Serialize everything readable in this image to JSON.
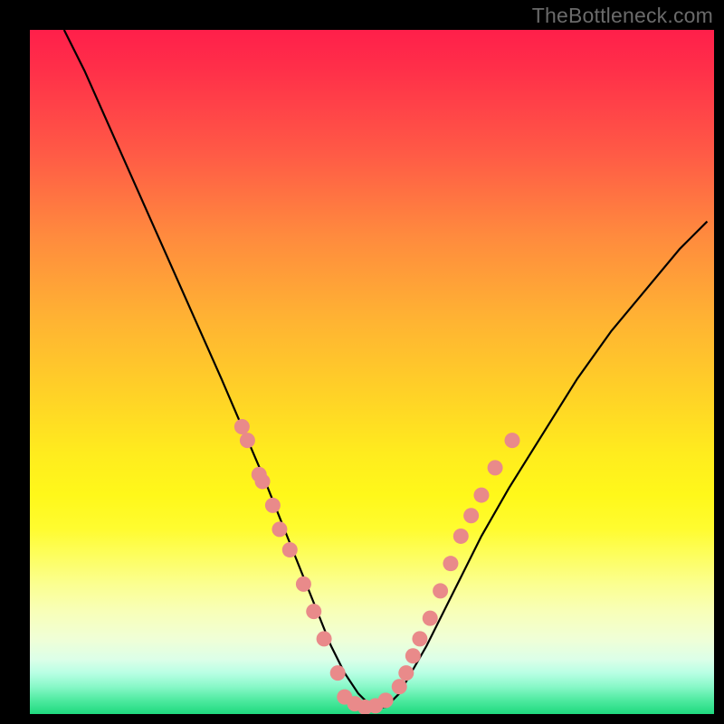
{
  "watermark": "TheBottleneck.com",
  "chart_data": {
    "type": "line",
    "title": "",
    "xlabel": "",
    "ylabel": "",
    "xlim": [
      0,
      100
    ],
    "ylim": [
      0,
      100
    ],
    "curve": {
      "name": "bottleneck-curve",
      "x": [
        5,
        8,
        12,
        16,
        20,
        24,
        28,
        31,
        34,
        36,
        38,
        40,
        42,
        44,
        46,
        48,
        50,
        52,
        54,
        58,
        62,
        66,
        70,
        75,
        80,
        85,
        90,
        95,
        99
      ],
      "y": [
        100,
        94,
        85,
        76,
        67,
        58,
        49,
        42,
        35,
        30,
        25,
        20,
        15,
        10,
        6,
        3,
        1,
        1,
        3,
        10,
        18,
        26,
        33,
        41,
        49,
        56,
        62,
        68,
        72
      ]
    },
    "scatter_left": {
      "name": "dots-left-branch",
      "color": "#e98a8a",
      "x": [
        31.0,
        31.8,
        33.5,
        34.0,
        35.5,
        36.5,
        38.0,
        40.0,
        41.5,
        43.0,
        45.0
      ],
      "y": [
        42.0,
        40.0,
        35.0,
        34.0,
        30.5,
        27.0,
        24.0,
        19.0,
        15.0,
        11.0,
        6.0
      ]
    },
    "scatter_right": {
      "name": "dots-right-branch",
      "color": "#e98a8a",
      "x": [
        54.0,
        55.0,
        56.0,
        57.0,
        58.5,
        60.0,
        61.5,
        63.0,
        64.5,
        66.0,
        68.0,
        70.5
      ],
      "y": [
        4.0,
        6.0,
        8.5,
        11.0,
        14.0,
        18.0,
        22.0,
        26.0,
        29.0,
        32.0,
        36.0,
        40.0
      ]
    },
    "scatter_bottom": {
      "name": "dots-valley",
      "color": "#e98a8a",
      "x": [
        46.0,
        47.5,
        49.0,
        50.5,
        52.0
      ],
      "y": [
        2.5,
        1.5,
        1.0,
        1.2,
        2.0
      ]
    }
  }
}
